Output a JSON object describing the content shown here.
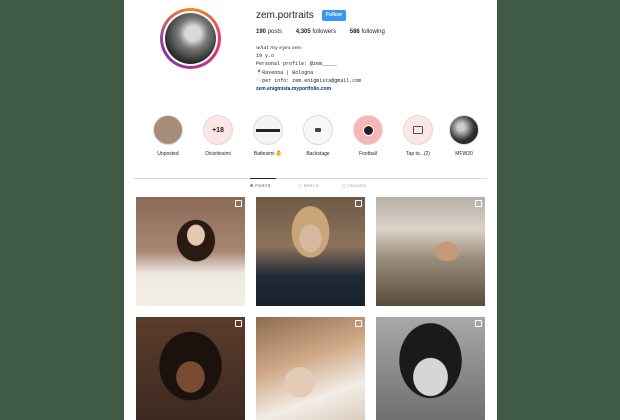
{
  "profile": {
    "username": "zem.portraits",
    "follow_label": "Follow",
    "posts_count": "190",
    "posts_label": "posts",
    "followers_count": "4,305",
    "followers_label": "followers",
    "following_count": "586",
    "following_label": "following"
  },
  "bio": {
    "line1": "what my eyes see:",
    "line2": "19 y.o",
    "line3": "Personal profile: @zem_____",
    "line4": "📍Ravenna | Bologna",
    "line5": "✉️per info: zem.enigmista@gmail.com",
    "link": "zem.enigmista.myportfolio.com"
  },
  "highlights": [
    {
      "label": "Unposted",
      "icon": "photo"
    },
    {
      "label": "Diciottesimi",
      "icon": "+18"
    },
    {
      "label": "Battesimi 👶",
      "icon": "stripe"
    },
    {
      "label": "Backstage",
      "icon": "camera"
    },
    {
      "label": "Football",
      "icon": "ball"
    },
    {
      "label": "Tap to...(2)",
      "icon": "camera-outline"
    },
    {
      "label": "MFW20",
      "icon": "photo-dark"
    }
  ],
  "tabs": [
    {
      "label": "⊞ POSTS",
      "active": true
    },
    {
      "label": "▢ REELS",
      "active": false
    },
    {
      "label": "▢ TAGGED",
      "active": false
    }
  ],
  "colors": {
    "background": "#3f5b45",
    "follow_button": "#3897f0",
    "highlight_fill": "#fde6e6"
  }
}
